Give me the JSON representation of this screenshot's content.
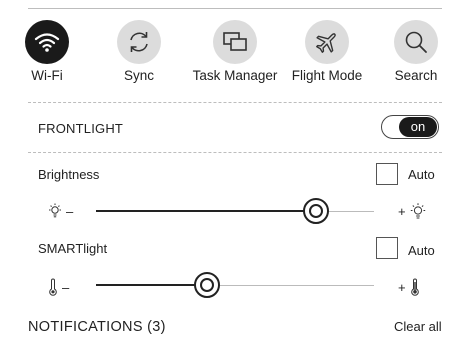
{
  "quick_actions": [
    {
      "label": "Wi-Fi",
      "icon": "wifi-icon",
      "active": true
    },
    {
      "label": "Sync",
      "icon": "sync-icon",
      "active": false
    },
    {
      "label": "Task Manager",
      "icon": "task-manager-icon",
      "active": false
    },
    {
      "label": "Flight Mode",
      "icon": "airplane-icon",
      "active": false
    },
    {
      "label": "Search",
      "icon": "search-icon",
      "active": false
    }
  ],
  "frontlight": {
    "label": "FRONTLIGHT",
    "toggle_label": "on",
    "enabled": true
  },
  "brightness": {
    "label": "Brightness",
    "auto_label": "Auto",
    "auto_checked": false,
    "minus_label": "–",
    "plus_label": "+",
    "value_fraction": 0.79
  },
  "smartlight": {
    "label": "SMARTlight",
    "auto_label": "Auto",
    "auto_checked": false,
    "minus_label": "–",
    "plus_label": "+",
    "value_fraction": 0.4
  },
  "notifications": {
    "title": "NOTIFICATIONS (3)",
    "clear_label": "Clear all"
  },
  "colors": {
    "active": "#1a1a1a",
    "inactive": "#dcdcdc",
    "text": "#222222"
  }
}
